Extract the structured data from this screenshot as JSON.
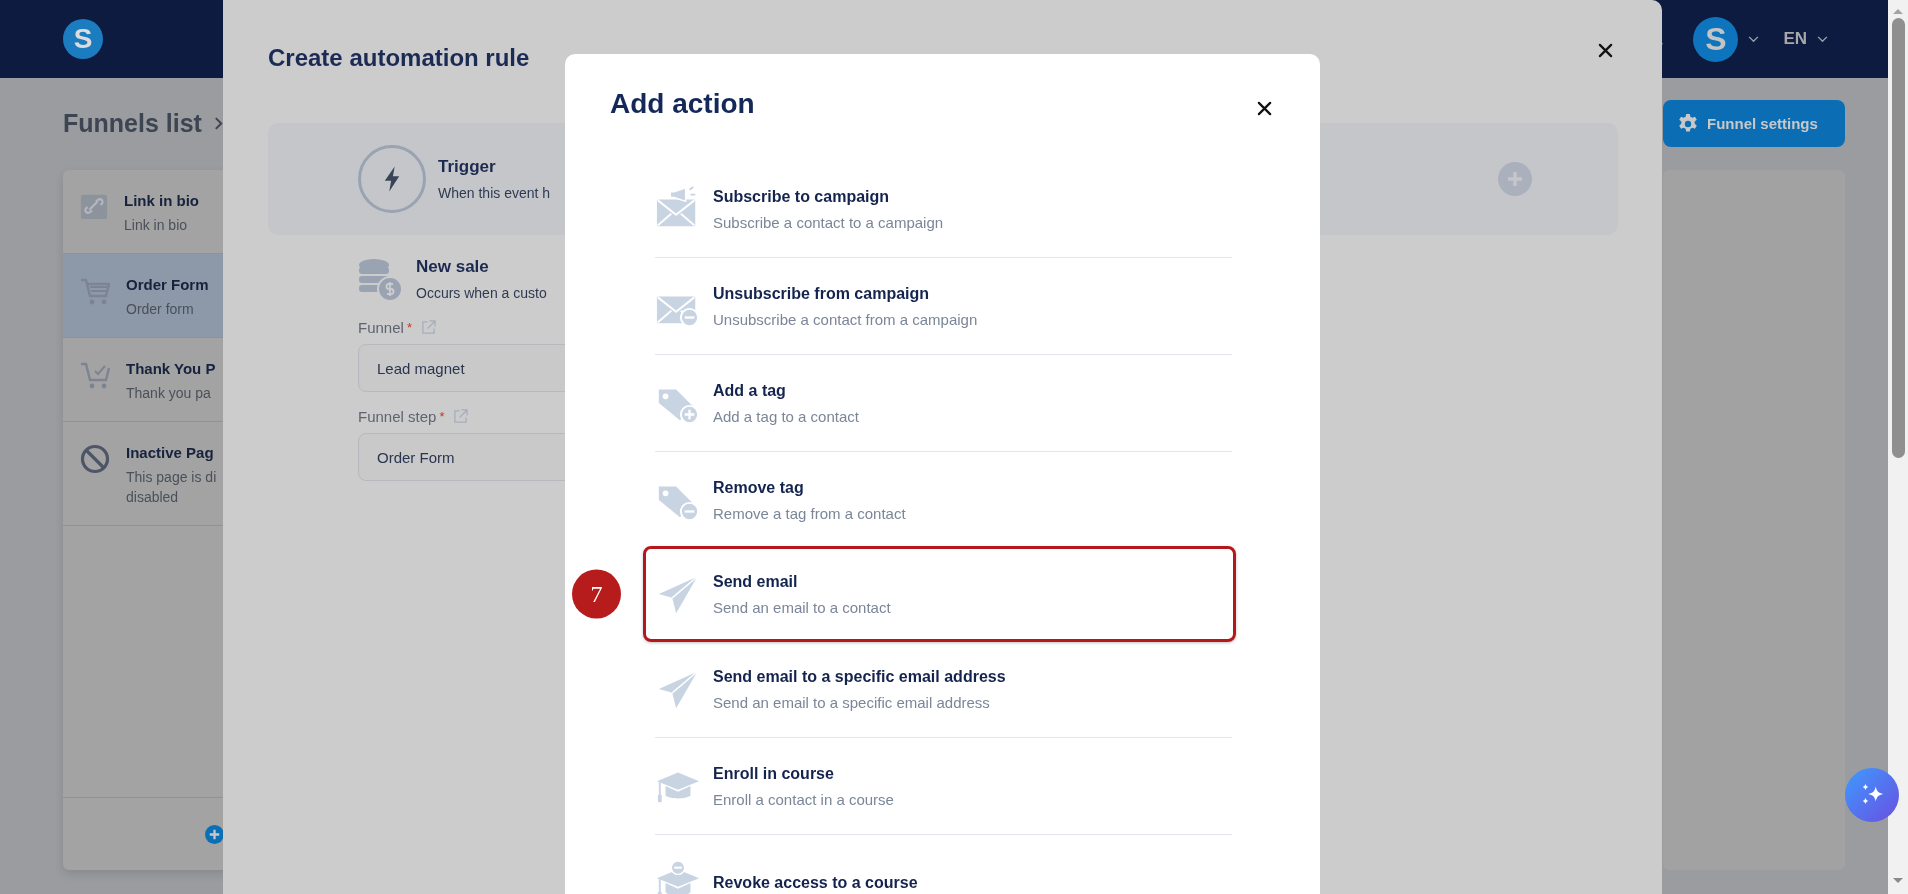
{
  "top_bar": {
    "logo": "S",
    "avatar": "S",
    "language": "EN"
  },
  "page": {
    "breadcrumb": "Funnels list",
    "pages": [
      {
        "kind": "link",
        "title": "Link in bio",
        "lines": [
          "Link in bio"
        ],
        "selected": false
      },
      {
        "kind": "cart",
        "title": "Order Form",
        "lines": [
          "Order form"
        ],
        "selected": true
      },
      {
        "kind": "cart-check",
        "title": "Thank You P",
        "lines": [
          "Thank you pa"
        ],
        "selected": false
      },
      {
        "kind": "inactive",
        "title": "Inactive Pag",
        "lines": [
          "This page is di",
          "disabled"
        ],
        "selected": false
      }
    ],
    "settings_button": "Funnel settings"
  },
  "automation_modal": {
    "title": "Create automation rule",
    "trigger": {
      "title": "Trigger",
      "description": "When this event h"
    },
    "event": {
      "title": "New sale",
      "description": "Occurs when a custo"
    },
    "fields": [
      {
        "label": "Funnel",
        "required_mark": "*",
        "value": "Lead magnet"
      },
      {
        "label": "Funnel step",
        "required_mark": "*",
        "value": "Order Form"
      }
    ]
  },
  "add_action": {
    "title": "Add action",
    "actions": [
      {
        "kind": "subscribe",
        "title": "Subscribe to campaign",
        "description": "Subscribe a contact to a campaign",
        "highlighted": false
      },
      {
        "kind": "unsubscribe",
        "title": "Unsubscribe from campaign",
        "description": "Unsubscribe a contact from a campaign",
        "highlighted": false
      },
      {
        "kind": "tag-add",
        "title": "Add a tag",
        "description": "Add a tag to a contact",
        "highlighted": false
      },
      {
        "kind": "tag-remove",
        "title": "Remove tag",
        "description": "Remove a tag from a contact",
        "highlighted": false
      },
      {
        "kind": "send",
        "title": "Send email",
        "description": "Send an email to a contact",
        "highlighted": true,
        "step_badge": "7"
      },
      {
        "kind": "send",
        "title": "Send email to a specific email address",
        "description": "Send an email to a specific email address",
        "highlighted": false
      },
      {
        "kind": "enroll",
        "title": "Enroll in course",
        "description": "Enroll a contact in a course",
        "highlighted": false
      },
      {
        "kind": "revoke",
        "title": "Revoke access to a course",
        "highlighted": false
      }
    ]
  }
}
